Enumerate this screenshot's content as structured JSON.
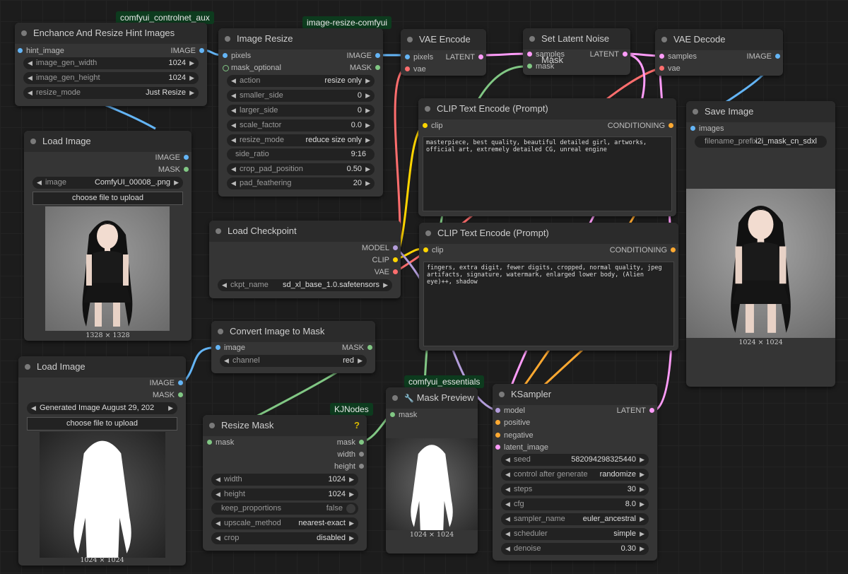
{
  "badges": {
    "controlnet_aux": "comfyui_controlnet_aux",
    "resize_comfyui": "image-resize-comfyui",
    "kjnodes": "KJNodes",
    "essentials": "comfyui_essentials"
  },
  "colors": {
    "image": "#64b5f6",
    "mask": "#81c784",
    "latent": "#ff9cf9",
    "vae": "#ff6e6e",
    "clip": "#ffd500",
    "conditioning": "#ffa931",
    "model": "#b39ddb"
  },
  "hint": {
    "title": "Enchance And Resize Hint Images",
    "in_hint": "hint_image",
    "out_image": "IMAGE",
    "w_width": {
      "label": "image_gen_width",
      "value": "1024"
    },
    "w_height": {
      "label": "image_gen_height",
      "value": "1024"
    },
    "w_mode": {
      "label": "resize_mode",
      "value": "Just Resize"
    }
  },
  "load1": {
    "title": "Load Image",
    "out_image": "IMAGE",
    "out_mask": "MASK",
    "w_image": {
      "label": "image",
      "value": "ComfyUI_00008_.png"
    },
    "upload": "choose file to upload",
    "caption": "1328 × 1328"
  },
  "resize": {
    "title": "Image Resize",
    "in_pixels": "pixels",
    "in_mask": "mask_optional",
    "out_image": "IMAGE",
    "out_mask": "MASK",
    "widgets": [
      {
        "label": "action",
        "value": "resize only"
      },
      {
        "label": "smaller_side",
        "value": "0"
      },
      {
        "label": "larger_side",
        "value": "0"
      },
      {
        "label": "scale_factor",
        "value": "0.0"
      },
      {
        "label": "resize_mode",
        "value": "reduce size only"
      },
      {
        "label": "side_ratio",
        "value": "9:16"
      },
      {
        "label": "crop_pad_position",
        "value": "0.50"
      },
      {
        "label": "pad_feathering",
        "value": "20"
      }
    ]
  },
  "vaeenc": {
    "title": "VAE Encode",
    "in_pixels": "pixels",
    "in_vae": "vae",
    "out_latent": "LATENT"
  },
  "noise": {
    "title": "Set Latent Noise Mask",
    "in_samples": "samples",
    "in_mask": "mask",
    "out_latent": "LATENT"
  },
  "vaedec": {
    "title": "VAE Decode",
    "in_samples": "samples",
    "in_vae": "vae",
    "out_image": "IMAGE"
  },
  "clip1": {
    "title": "CLIP Text Encode (Prompt)",
    "in_clip": "clip",
    "out": "CONDITIONING",
    "text": "masterpiece, best quality, beautiful detailed girl, artworks, official art, extremely detailed CG, unreal engine"
  },
  "clip2": {
    "title": "CLIP Text Encode (Prompt)",
    "in_clip": "clip",
    "out": "CONDITIONING",
    "text": "fingers, extra digit, fewer digits, cropped, normal quality, jpeg artifacts, signature, watermark, enlarged lower body, (Alien eye)++, shadow"
  },
  "save": {
    "title": "Save Image",
    "in_images": "images",
    "w_prefix": {
      "label": "filename_prefix",
      "value": "i2i_mask_cn_sdxl"
    },
    "caption": "1024 × 1024"
  },
  "ckpt": {
    "title": "Load Checkpoint",
    "out_model": "MODEL",
    "out_clip": "CLIP",
    "out_vae": "VAE",
    "w_ckpt": {
      "label": "ckpt_name",
      "value": "sd_xl_base_1.0.safetensors"
    }
  },
  "convert": {
    "title": "Convert Image to Mask",
    "in_image": "image",
    "out_mask": "MASK",
    "w_channel": {
      "label": "channel",
      "value": "red"
    }
  },
  "load2": {
    "title": "Load Image",
    "out_image": "IMAGE",
    "out_mask": "MASK",
    "w_image": {
      "value": "Generated Image August 29, 202"
    },
    "upload": "choose file to upload",
    "caption": "1024 × 1024"
  },
  "rmask": {
    "title": "Resize Mask",
    "help": "?",
    "in_mask": "mask",
    "out_mask": "mask",
    "out_width": "width",
    "out_height": "height",
    "w_width": {
      "label": "width",
      "value": "1024"
    },
    "w_height": {
      "label": "height",
      "value": "1024"
    },
    "w_keep": {
      "label": "keep_proportions",
      "value": "false"
    },
    "w_upscale": {
      "label": "upscale_method",
      "value": "nearest-exact"
    },
    "w_crop": {
      "label": "crop",
      "value": "disabled"
    }
  },
  "mprev": {
    "title": "Mask Preview",
    "icon": "🔧",
    "in_mask": "mask",
    "caption": "1024 × 1024"
  },
  "ksampler": {
    "title": "KSampler",
    "in_model": "model",
    "in_positive": "positive",
    "in_negative": "negative",
    "in_latent": "latent_image",
    "out_latent": "LATENT",
    "widgets": [
      {
        "label": "seed",
        "value": "582094298325440"
      },
      {
        "label": "control after generate",
        "value": "randomize"
      },
      {
        "label": "steps",
        "value": "30"
      },
      {
        "label": "cfg",
        "value": "8.0"
      },
      {
        "label": "sampler_name",
        "value": "euler_ancestral"
      },
      {
        "label": "scheduler",
        "value": "simple"
      },
      {
        "label": "denoise",
        "value": "0.30"
      }
    ]
  }
}
